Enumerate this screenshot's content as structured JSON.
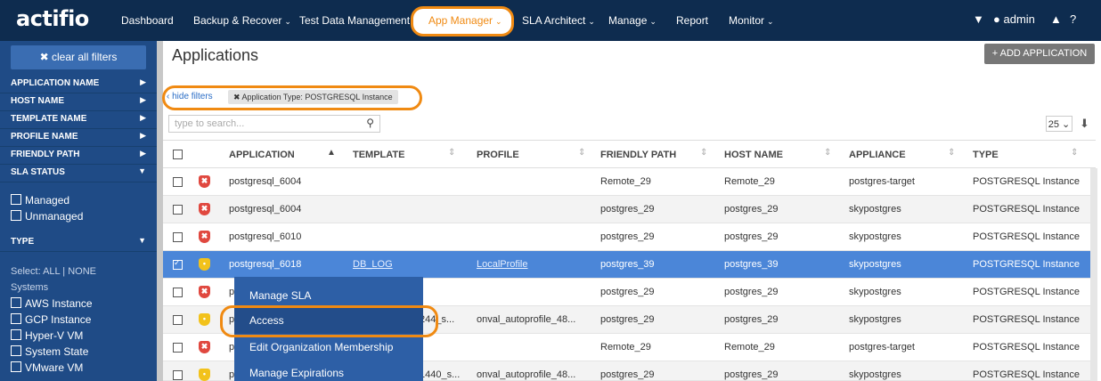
{
  "brand": {
    "logo": "actifio"
  },
  "nav": {
    "items": [
      {
        "label": "Dashboard",
        "caret": ""
      },
      {
        "label": "Backup & Recover",
        "caret": "⌄"
      },
      {
        "label": "Test Data Management",
        "caret": "⌄"
      },
      {
        "label": "App Manager",
        "caret": "⌄"
      },
      {
        "label": "SLA Architect",
        "caret": "⌄"
      },
      {
        "label": "Manage",
        "caret": "⌄"
      },
      {
        "label": "Report",
        "caret": ""
      },
      {
        "label": "Monitor",
        "caret": "⌄"
      }
    ],
    "user": "admin"
  },
  "sidebar": {
    "clear_label": "clear all filters",
    "filters": [
      "APPLICATION NAME",
      "HOST NAME",
      "TEMPLATE NAME",
      "PROFILE NAME",
      "FRIENDLY PATH",
      "SLA STATUS"
    ],
    "sla_options": [
      "Managed",
      "Unmanaged"
    ],
    "type_label": "TYPE",
    "select_all_label": "Select: ALL | NONE",
    "systems_label": "Systems",
    "systems": [
      "AWS Instance",
      "GCP Instance",
      "Hyper-V VM",
      "System State",
      "VMware VM"
    ]
  },
  "main": {
    "title": "Applications",
    "add_label": "+ ADD APPLICATION",
    "hide_filters": "‹ hide filters",
    "active_filter": "✖ Application Type: POSTGRESQL Instance",
    "search_placeholder": "type to search...",
    "page_size": "25 ⌄"
  },
  "table": {
    "columns": [
      "APPLICATION",
      "TEMPLATE",
      "PROFILE",
      "FRIENDLY PATH",
      "HOST NAME",
      "APPLIANCE",
      "TYPE"
    ],
    "rows": [
      {
        "app": "postgresql_6004",
        "template": "",
        "profile": "",
        "path": "Remote_29",
        "host": "Remote_29",
        "appliance": "postgres-target",
        "type": "POSTGRESQL Instance",
        "shield": "red",
        "selected": false
      },
      {
        "app": "postgresql_6004",
        "template": "",
        "profile": "",
        "path": "postgres_29",
        "host": "postgres_29",
        "appliance": "skypostgres",
        "type": "POSTGRESQL Instance",
        "shield": "red",
        "selected": false
      },
      {
        "app": "postgresql_6010",
        "template": "",
        "profile": "",
        "path": "postgres_29",
        "host": "postgres_29",
        "appliance": "skypostgres",
        "type": "POSTGRESQL Instance",
        "shield": "red",
        "selected": false
      },
      {
        "app": "postgresql_6018",
        "template": "DB_LOG",
        "profile": "LocalProfile",
        "path": "postgres_39",
        "host": "postgres_39",
        "appliance": "skypostgres",
        "type": "POSTGRESQL Instance",
        "shield": "yellow",
        "selected": true
      },
      {
        "app": "p",
        "template": "",
        "profile": "",
        "path": "postgres_29",
        "host": "postgres_29",
        "appliance": "skypostgres",
        "type": "POSTGRESQL Instance",
        "shield": "red",
        "selected": false
      },
      {
        "app": "p",
        "template": "244_s...",
        "profile": "onval_autoprofile_48...",
        "path": "postgres_29",
        "host": "postgres_29",
        "appliance": "skypostgres",
        "type": "POSTGRESQL Instance",
        "shield": "yellow",
        "selected": false
      },
      {
        "app": "p",
        "template": "",
        "profile": "",
        "path": "Remote_29",
        "host": "Remote_29",
        "appliance": "postgres-target",
        "type": "POSTGRESQL Instance",
        "shield": "red",
        "selected": false
      },
      {
        "app": "p",
        "template": "1440_s...",
        "profile": "onval_autoprofile_48...",
        "path": "postgres_29",
        "host": "postgres_29",
        "appliance": "skypostgres",
        "type": "POSTGRESQL Instance",
        "shield": "yellow",
        "selected": false
      }
    ]
  },
  "context_menu": {
    "items": [
      "Manage SLA",
      "Access",
      "Edit Organization Membership",
      "Manage Expirations"
    ],
    "active": "Access"
  },
  "colors": {
    "nav_bg": "#0e2c4f",
    "sidebar_bg": "#1f4b86",
    "selected_row": "#4b86d8",
    "highlight": "#f08a12"
  }
}
